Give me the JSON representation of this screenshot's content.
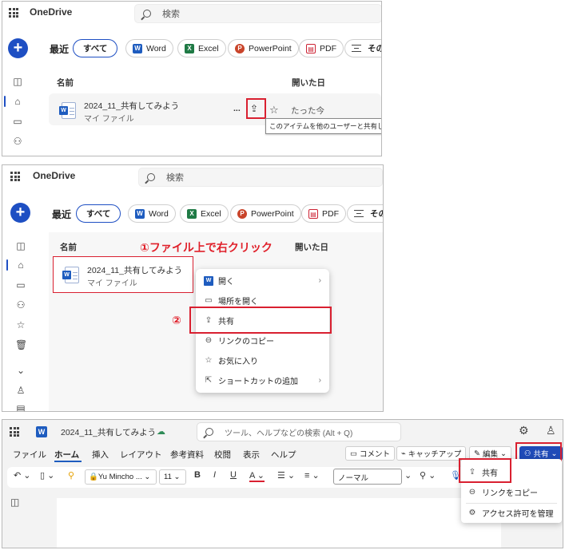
{
  "panel1": {
    "brand": "OneDrive",
    "search_placeholder": "検索",
    "section_title": "最近",
    "filters": {
      "all": "すべて",
      "word": "Word",
      "excel": "Excel",
      "powerpoint": "PowerPoint",
      "pdf": "PDF",
      "other": "その"
    },
    "col_name": "名前",
    "col_opened": "開いた日",
    "file_name": "2024_11_共有してみよう",
    "file_location": "マイ ファイル",
    "file_more": "...",
    "file_opened": "たった今",
    "share_tooltip": "このアイテムを他のユーザーと共有します"
  },
  "panel2": {
    "brand": "OneDrive",
    "search_placeholder": "検索",
    "section_title": "最近",
    "filters": {
      "all": "すべて",
      "word": "Word",
      "excel": "Excel",
      "powerpoint": "PowerPoint",
      "pdf": "PDF",
      "other": "その"
    },
    "col_name": "名前",
    "col_opened": "開いた日",
    "annotation1": "①ファイル上で右クリック",
    "annotation2": "②",
    "file_name": "2024_11_共有してみよう",
    "file_location": "マイ ファイル",
    "context_menu": {
      "open": "開く",
      "open_location": "場所を開く",
      "share": "共有",
      "copy_link": "リンクのコピー",
      "favorite": "お気に入り",
      "add_shortcut": "ショートカットの追加"
    }
  },
  "panel3": {
    "doc_title": "2024_11_共有してみよう",
    "search_placeholder": "ツール、ヘルプなどの検索 (Alt + Q)",
    "tabs": {
      "file": "ファイル",
      "home": "ホーム",
      "insert": "挿入",
      "layout": "レイアウト",
      "references": "参考資料",
      "review": "校閲",
      "view": "表示",
      "help": "ヘルプ"
    },
    "comment_btn": "コメント",
    "catchup_btn": "キャッチアップ",
    "edit_btn": "編集",
    "share_btn": "共有",
    "font_name": "Yu Mincho ...",
    "font_size": "11",
    "style_name": "ノーマル",
    "share_menu": {
      "share": "共有",
      "copy_link": "リンクをコピー",
      "manage_access": "アクセス許可を管理"
    }
  },
  "colors": {
    "accent": "#1e4fc3",
    "highlight": "#d92030",
    "share_button": "#1f4bb8"
  }
}
